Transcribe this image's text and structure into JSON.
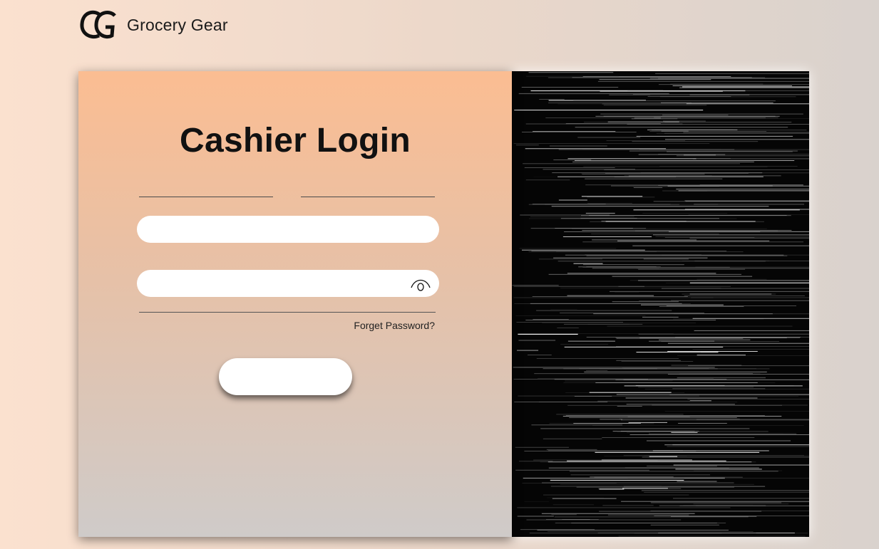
{
  "brand": {
    "name": "Grocery Gear",
    "logo_icon": "gg-monogram-icon"
  },
  "login": {
    "title": "Cashier Login",
    "username_value": "",
    "password_value": "",
    "forgot_label": "Forget Password?",
    "submit_label": "",
    "eye_icon": "eye-icon"
  },
  "colors": {
    "card_top": "#fbbd92",
    "card_bottom": "#cfcbc9",
    "visual_bg": "#050505",
    "text": "#111111"
  }
}
